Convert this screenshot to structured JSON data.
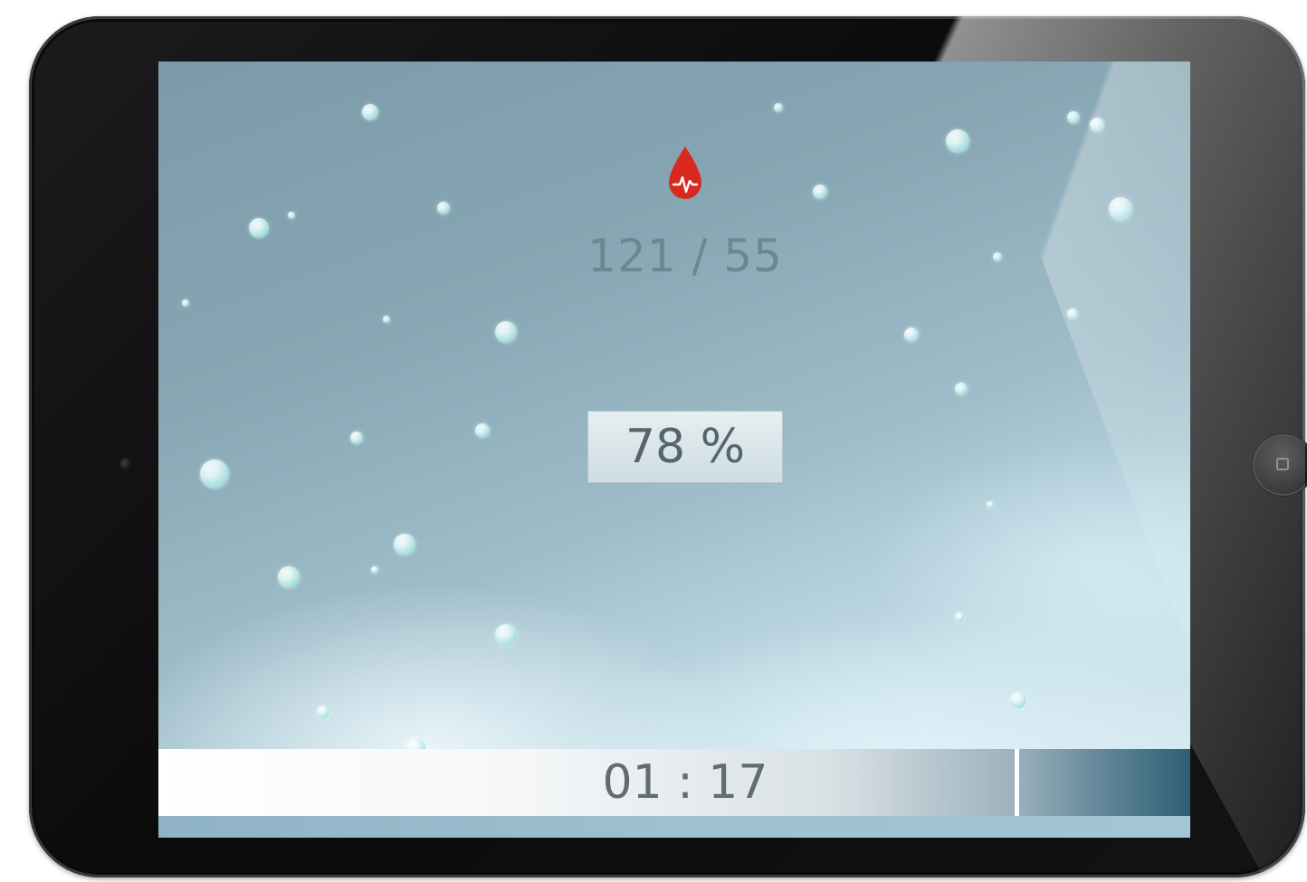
{
  "vitals": {
    "blood_pressure": "121 / 55",
    "icon": "blood-drop-pulse-icon"
  },
  "oxygen": {
    "saturation_label": "78 %"
  },
  "timer": {
    "elapsed": "01 : 17",
    "progress": 0.83
  },
  "colors": {
    "icon_red": "#d9281f",
    "bar_dark": "#2f5f74",
    "text_gray": "#5f6c72"
  }
}
